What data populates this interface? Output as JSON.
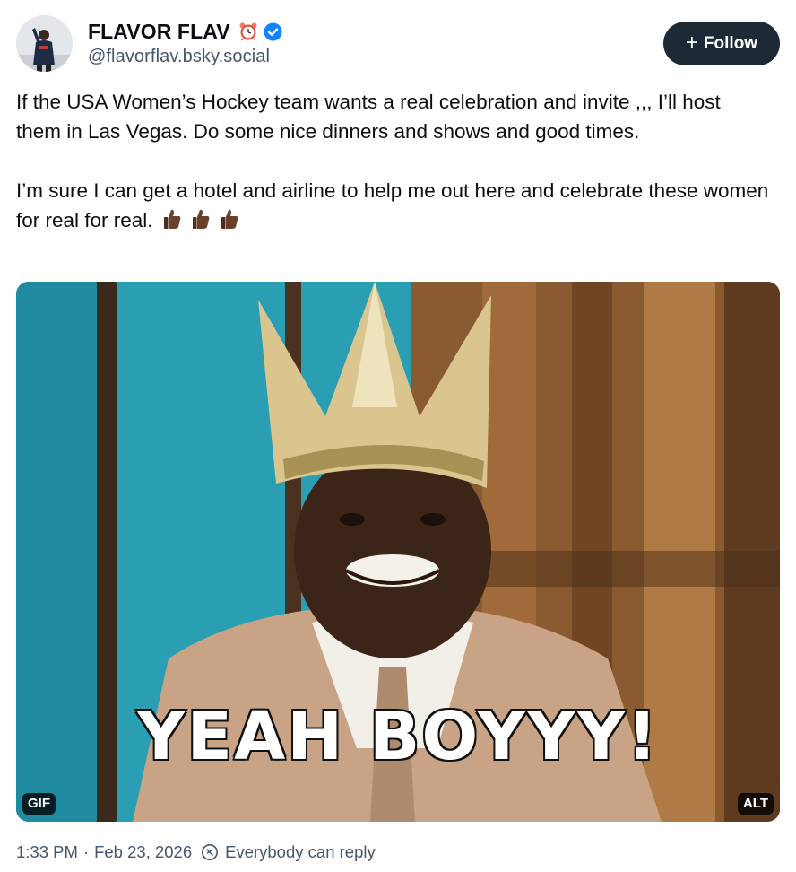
{
  "author": {
    "display_name": "FLAVOR FLAV",
    "handle": "@flavorflav.bsky.social",
    "avatar_icon": "avatar",
    "name_emoji_icon": "alarm-clock-icon",
    "verified_icon": "verified-badge-icon"
  },
  "follow": {
    "plus": "+",
    "label": "Follow"
  },
  "post": {
    "paragraph_1": "If the USA Women’s Hockey team wants a real celebration and invite ,,, I’ll host them in Las Vegas. Do some nice dinners and shows and good times.",
    "paragraph_2": "I’m sure I can get a hotel and airline to help me out here and celebrate these women for real for real.",
    "thumbs_icons": [
      "thumbs-up-icon",
      "thumbs-up-icon",
      "thumbs-up-icon"
    ]
  },
  "media": {
    "caption": "YEAH BOYYY!",
    "gif_badge": "GIF",
    "alt_badge": "ALT"
  },
  "footer": {
    "time": "1:33 PM",
    "separator": "·",
    "date": "Feb 23, 2026",
    "reply_setting": "Everybody can reply"
  },
  "colors": {
    "text": "#0b0f14",
    "secondary_text": "#42576c",
    "button_bg": "#1e2936",
    "verified": "#1083fe"
  }
}
